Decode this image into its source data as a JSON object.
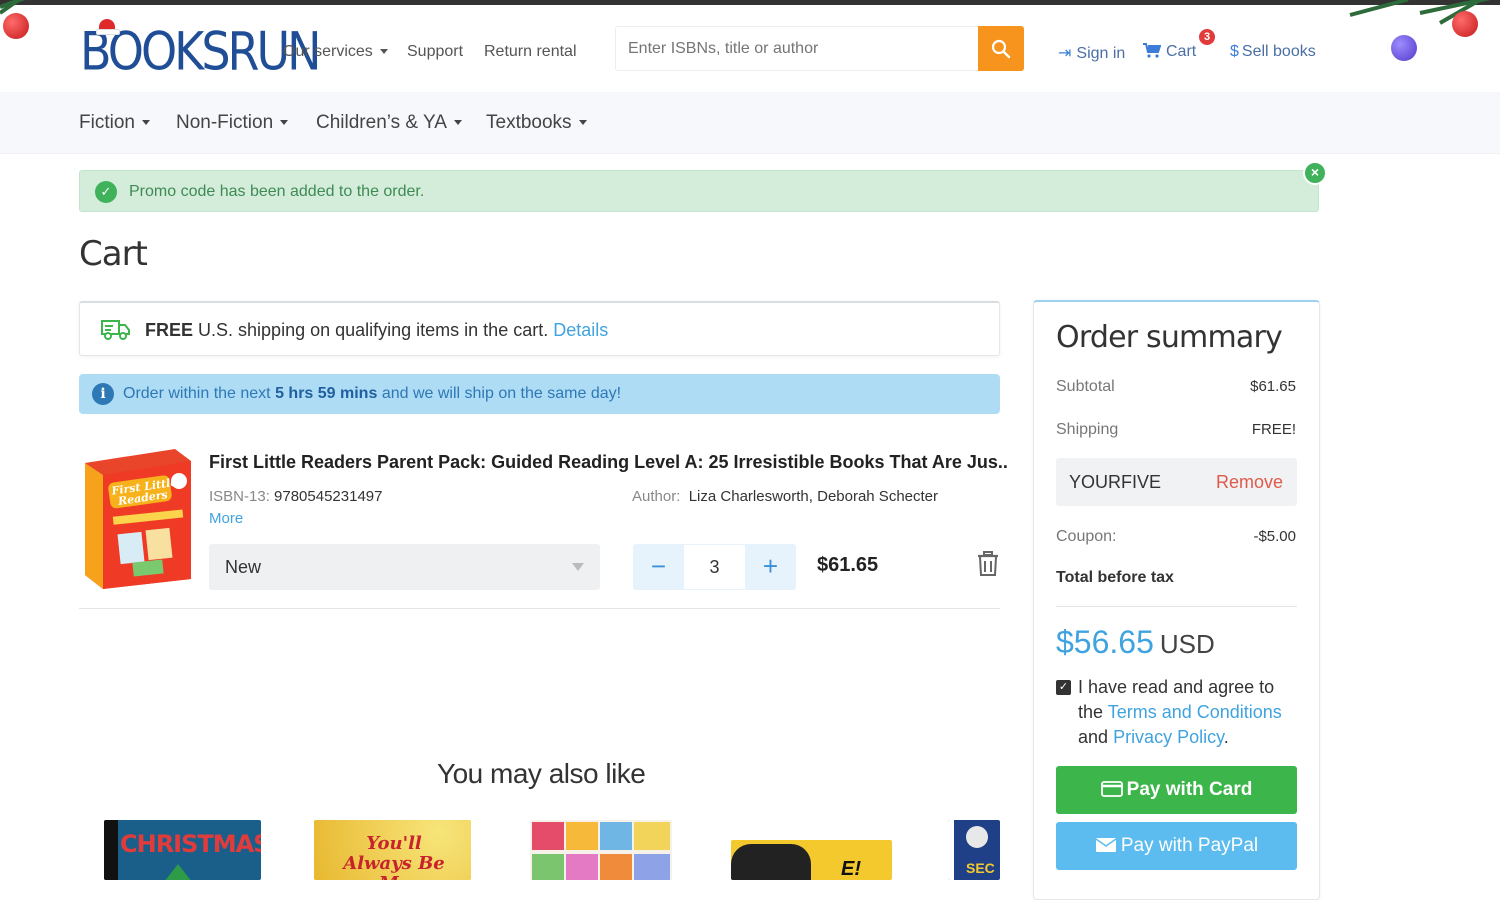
{
  "header": {
    "logo_text": "BOOKSRUN",
    "nav": [
      {
        "label": "Our services",
        "has_dropdown": true
      },
      {
        "label": "Support",
        "has_dropdown": false
      },
      {
        "label": "Return rental",
        "has_dropdown": false
      }
    ],
    "search": {
      "placeholder": "Enter ISBNs, title or author",
      "icon": "search-icon"
    },
    "sign_in": {
      "label": "Sign in",
      "icon": "sign-in-icon"
    },
    "cart": {
      "label": "Cart",
      "count": "3",
      "icon": "cart-icon"
    },
    "sell": {
      "label": "Sell books",
      "icon": "dollar-icon"
    }
  },
  "categories": [
    {
      "label": "Fiction"
    },
    {
      "label": "Non-Fiction"
    },
    {
      "label": "Children’s & YA"
    },
    {
      "label": "Textbooks"
    }
  ],
  "alert": {
    "message": "Promo code has been added to the order.",
    "icon": "check-circle-icon",
    "close_icon": "close-icon"
  },
  "page_title": "Cart",
  "shipping_notice": {
    "bold": "FREE",
    "text": "U.S. shipping on qualifying items in the cart.",
    "link": "Details",
    "icon": "truck-icon"
  },
  "timer_notice": {
    "prefix": "Order within the next",
    "bold": "5 hrs 59 mins",
    "suffix": "and we will ship on the same day!",
    "icon": "info-icon"
  },
  "cart_item": {
    "title": "First Little Readers Parent Pack: Guided Reading Level A: 25 Irresistible Books That Are Jus...",
    "isbn_label": "ISBN-13:",
    "isbn": "9780545231497",
    "more_label": "More",
    "author_label": "Author:",
    "author": "Liza Charlesworth, Deborah Schecter",
    "condition": "New",
    "quantity": "3",
    "minus": "−",
    "plus": "+",
    "price": "$61.65",
    "cover_text": [
      "First Little",
      "Readers"
    ]
  },
  "also_like": {
    "title": "You may also like",
    "cover_texts": [
      "CHRISTMAS",
      "You'll Always Be My",
      "",
      "E!",
      "SEC"
    ]
  },
  "summary": {
    "title": "Order summary",
    "subtotal_label": "Subtotal",
    "subtotal": "$61.65",
    "shipping_label": "Shipping",
    "shipping": "FREE!",
    "coupon_code": "YOURFIVE",
    "remove_label": "Remove",
    "coupon_label": "Coupon:",
    "coupon_value": "-$5.00",
    "total_label": "Total before tax",
    "total": "$56.65",
    "currency": "USD",
    "agree_prefix": "I have read and agree to the",
    "terms": "Terms and Conditions",
    "and": "and",
    "privacy": "Privacy Policy",
    "period": ".",
    "pay_card": "Pay with Card",
    "pay_paypal": "Pay with PayPal"
  },
  "colors": {
    "brand": "#1f4e96",
    "accent": "#3fa3e0",
    "search_button": "#f7941d",
    "pay_card": "#3cb64a",
    "pay_paypal": "#5cbcef",
    "alert_bg": "#d4edda",
    "info_bg": "#aedcf5"
  }
}
